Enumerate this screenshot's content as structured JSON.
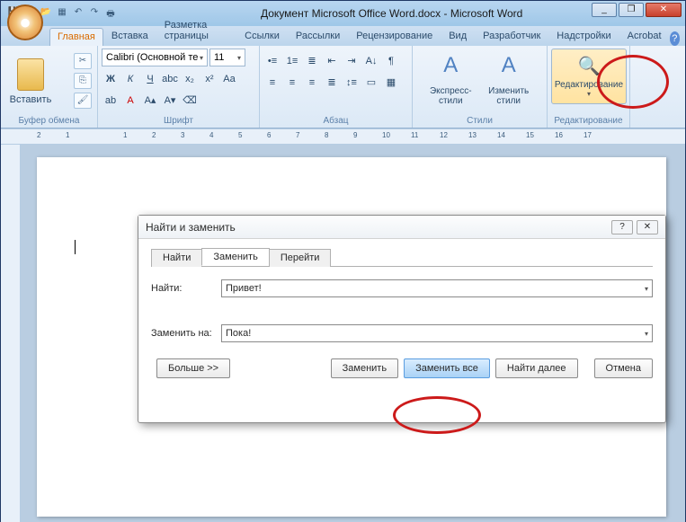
{
  "window": {
    "title": "Документ Microsoft Office Word.docx - Microsoft Word",
    "qat_tips": {
      "save": "💾",
      "undo": "↶",
      "redo": "↷",
      "new": "▫",
      "open": "📂",
      "quick": "▦",
      "print": "🖶"
    },
    "ctrls": {
      "min": "_",
      "max": "□",
      "restore": "❐",
      "close": "✕"
    }
  },
  "ribbon": {
    "tabs": {
      "home": "Главная",
      "insert": "Вставка",
      "layout": "Разметка страницы",
      "refs": "Ссылки",
      "mail": "Рассылки",
      "review": "Рецензирование",
      "view": "Вид",
      "dev": "Разработчик",
      "addins": "Надстройки",
      "acrobat": "Acrobat"
    },
    "groups": {
      "clipboard": "Буфер обмена",
      "font": "Шрифт",
      "paragraph": "Абзац",
      "styles": "Стили",
      "editing": "Редактирование"
    },
    "paste": "Вставить",
    "font_name": "Calibri (Основной те",
    "font_size": "11",
    "styles_quick": "Экспресс-стили",
    "styles_change": "Изменить стили",
    "editing_btn": "Редактирование"
  },
  "ruler": {
    "n2": "2",
    "n1": "1",
    "p1": "1",
    "p2": "2",
    "p3": "3",
    "p4": "4",
    "p5": "5",
    "p6": "6",
    "p7": "7",
    "p8": "8",
    "p9": "9",
    "p10": "10",
    "p11": "11",
    "p12": "12",
    "p13": "13",
    "p14": "14",
    "p15": "15",
    "p16": "16",
    "p17": "17"
  },
  "dialog": {
    "title": "Найти и заменить",
    "tab_find": "Найти",
    "tab_replace": "Заменить",
    "tab_goto": "Перейти",
    "label_find": "Найти:",
    "value_find": "Привет!",
    "label_replace": "Заменить на:",
    "value_replace": "Пока!",
    "btn_more": "Больше >>",
    "btn_replace": "Заменить",
    "btn_replace_all": "Заменить все",
    "btn_find_next": "Найти далее",
    "btn_cancel": "Отмена",
    "help": "?",
    "close": "✕"
  }
}
